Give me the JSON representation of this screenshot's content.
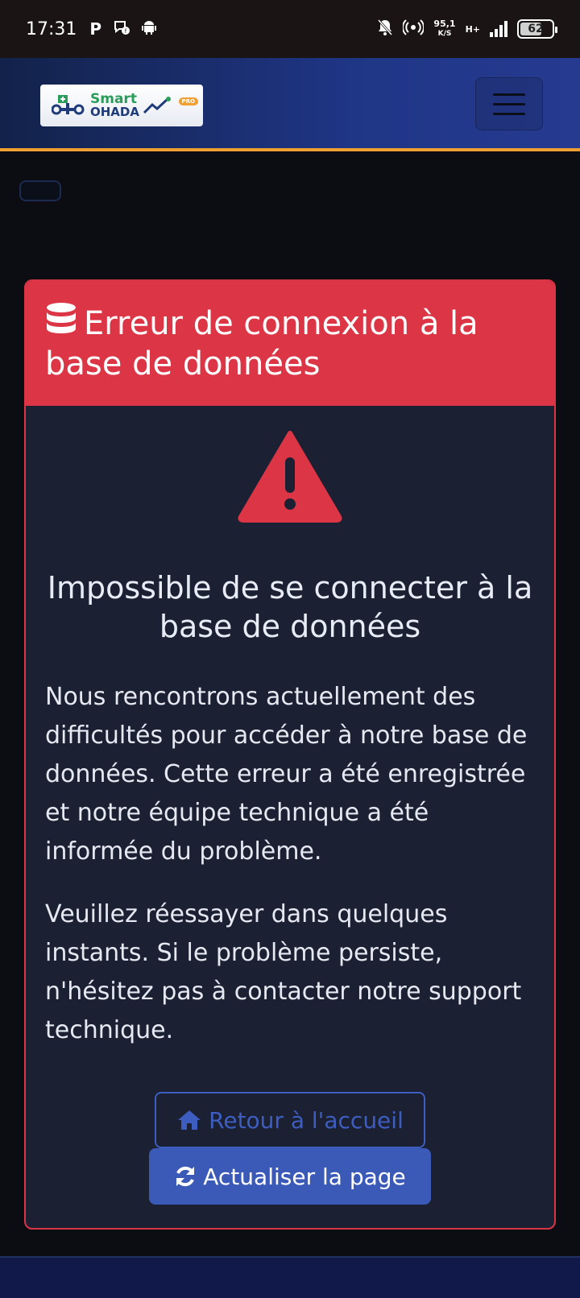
{
  "status_bar": {
    "time": "17:31",
    "net_speed_value": "95,1",
    "net_speed_unit": "K/S",
    "net_type": "H+",
    "battery": "62"
  },
  "navbar": {
    "logo_smart": "Smart",
    "logo_ohada": "OHADA",
    "logo_pro": "PRO"
  },
  "error_card": {
    "title": "Erreur de connexion à la base de données",
    "heading": "Impossible de se connecter à la base de données",
    "paragraph_1": "Nous rencontrons actuellement des difficultés pour accéder à notre base de données. Cette erreur a été enregistrée et notre équipe technique a été informée du problème.",
    "paragraph_2": "Veuillez réessayer dans quelques instants. Si le problème persiste, n'hésitez pas à contacter notre support technique.",
    "home_button": "Retour à l'accueil",
    "refresh_button": "Actualiser la page"
  },
  "colors": {
    "danger": "#dc3545",
    "primary": "#3b5ab8",
    "accent": "#f0a030",
    "card_bg": "#1b2032"
  }
}
